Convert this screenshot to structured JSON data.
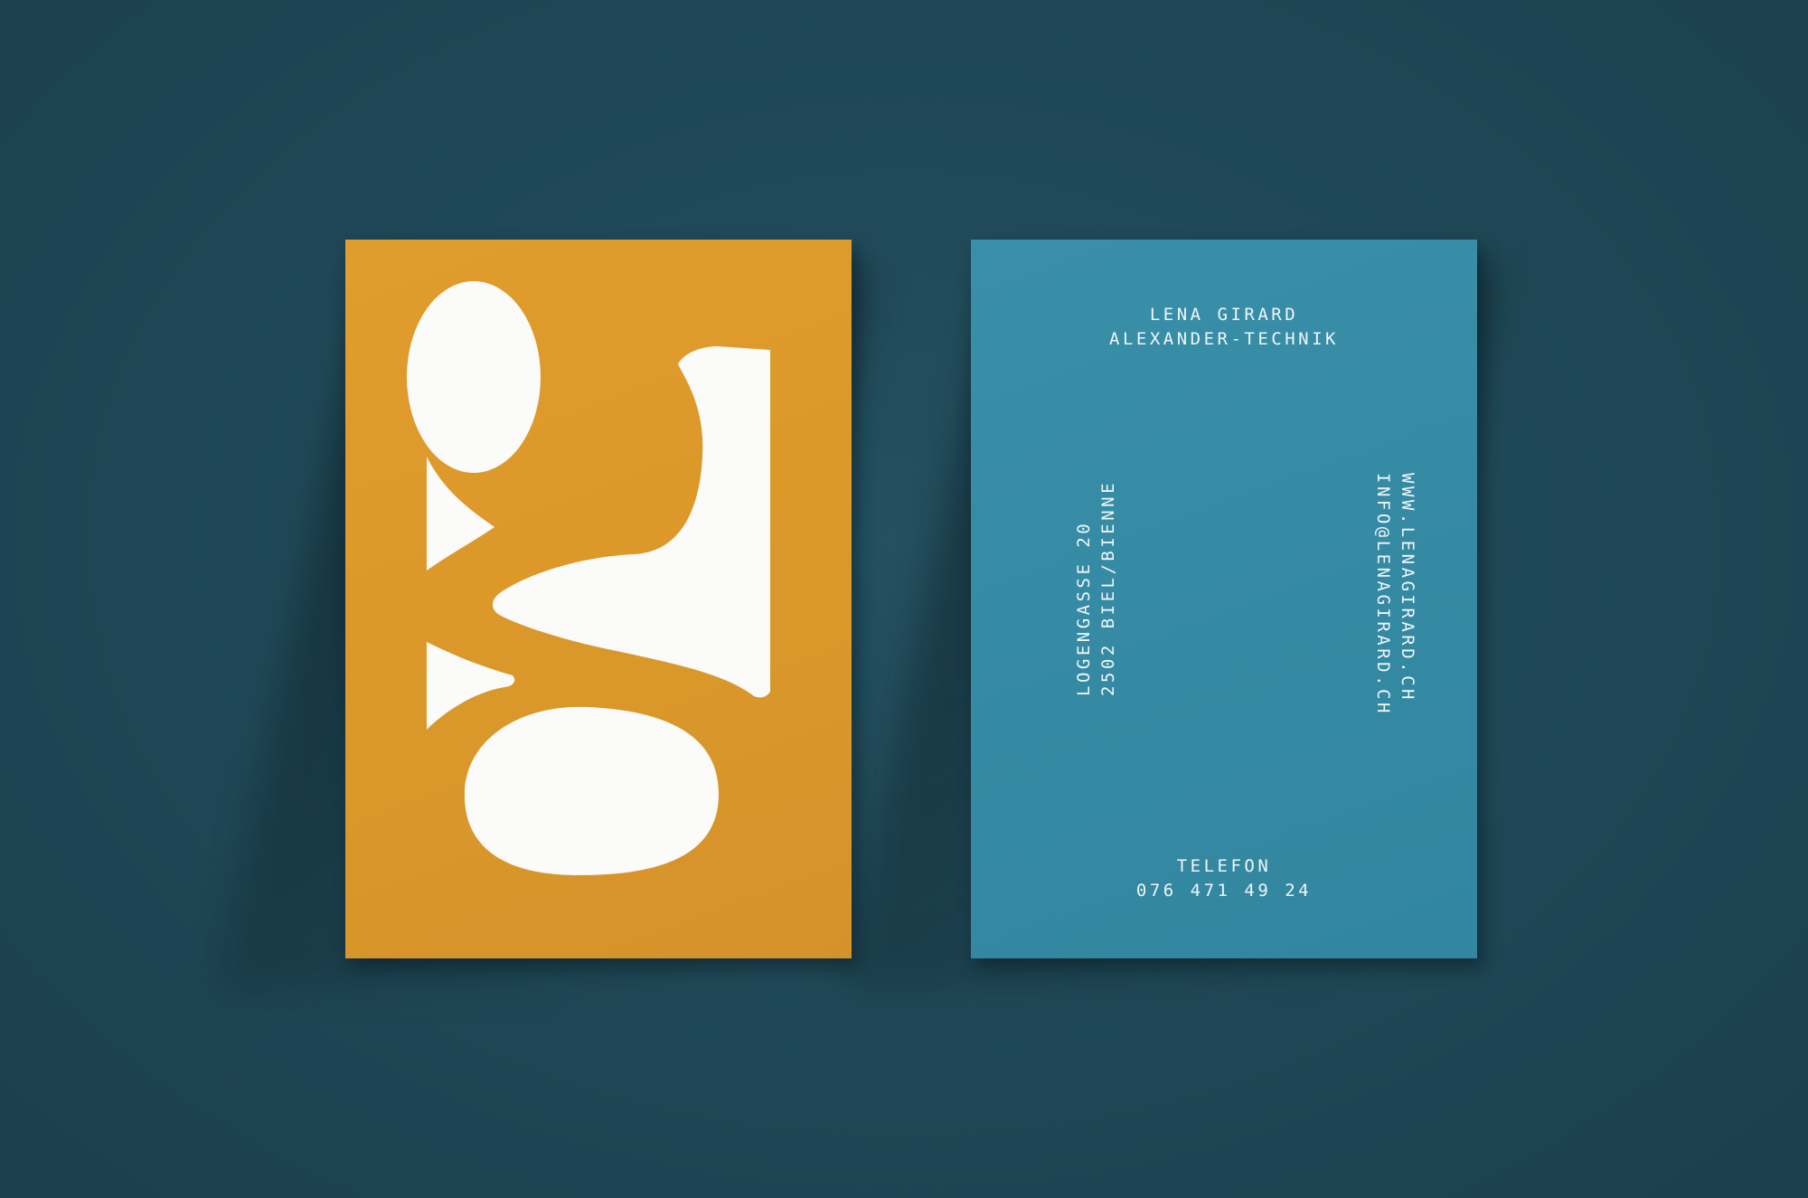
{
  "scene": {
    "background_color": "#1f4857"
  },
  "front_card": {
    "color": "#dd9a2b",
    "monogram_letter": "g",
    "monogram_color": "#fbfbfa"
  },
  "back_card": {
    "color": "#358aa3",
    "name": "LENA GIRARD",
    "profession": "ALEXANDER-TECHNIK",
    "address": {
      "street": "LOGENGASSE 20",
      "city": "2502 BIEL/BIENNE"
    },
    "online": {
      "website": "WWW.LENAGIRARD.CH",
      "email": "INFO@LENAGIRARD.CH"
    },
    "phone": {
      "label": "TELEFON",
      "number": "076 471 49 24"
    }
  }
}
